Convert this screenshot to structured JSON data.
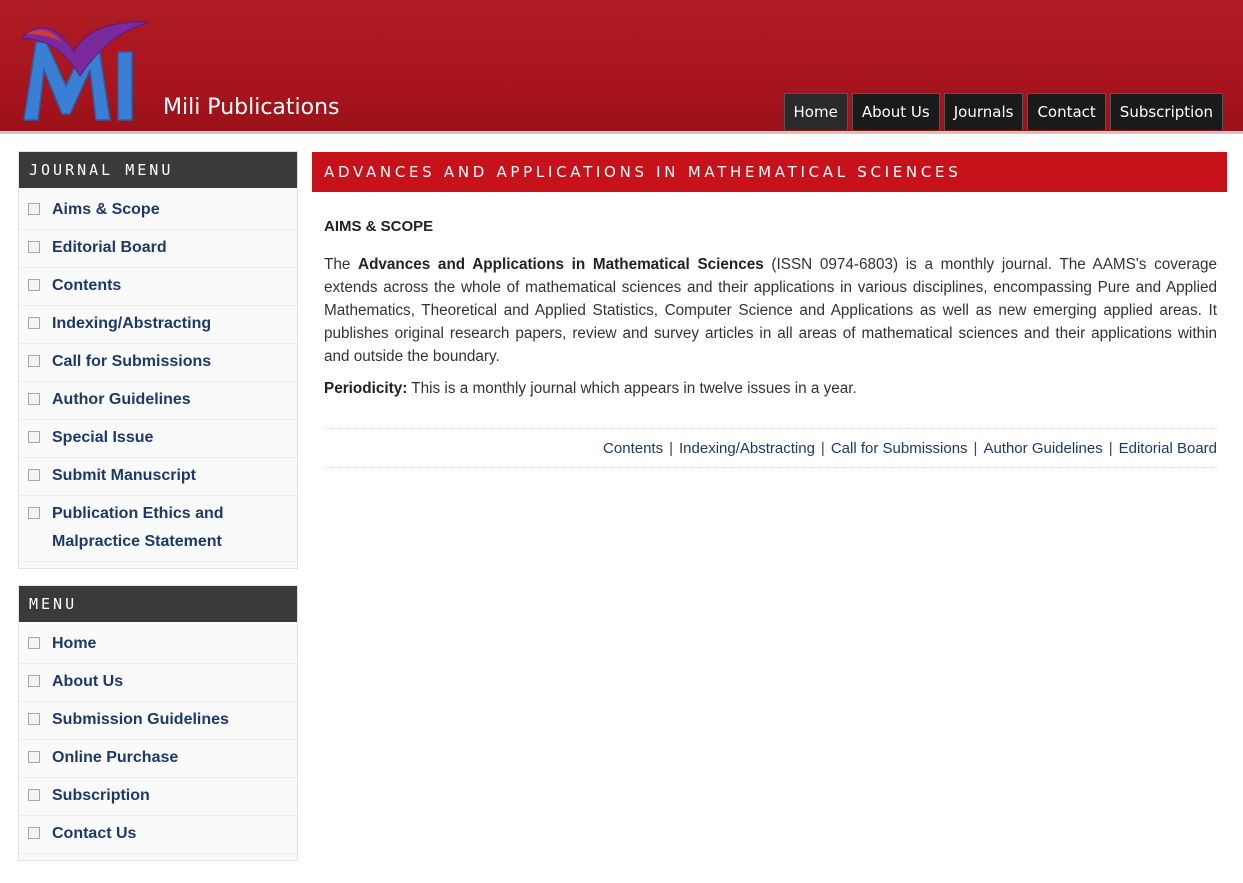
{
  "header": {
    "site_title": "Mili Publications",
    "nav": [
      "Home",
      "About Us",
      "Journals",
      "Contact",
      "Subscription"
    ],
    "active_nav": "Home"
  },
  "sidebar": {
    "journal_menu": {
      "heading": "JOURNAL MENU",
      "items": [
        "Aims & Scope",
        "Editorial Board",
        "Contents",
        "Indexing/Abstracting",
        "Call for Submissions",
        "Author Guidelines",
        "Special Issue",
        "Submit Manuscript",
        "Publication Ethics and Malpractice Statement"
      ]
    },
    "menu": {
      "heading": "MENU",
      "items": [
        "Home",
        "About Us",
        "Submission Guidelines",
        "Online Purchase",
        "Subscription",
        "Contact Us"
      ]
    }
  },
  "main": {
    "journal_title": "ADVANCES AND APPLICATIONS IN MATHEMATICAL SCIENCES",
    "section_title": "AIMS & SCOPE",
    "intro_prefix": "The ",
    "intro_bold": "Advances and Applications in Mathematical Sciences",
    "intro_rest": " (ISSN 0974-6803) is a monthly journal. The AAMS's coverage extends across the whole of mathematical sciences and their applications in various disciplines, encompassing Pure and Applied Mathematics, Theoretical and Applied Statistics, Computer Science and Applications as well as new emerging applied areas. It publishes original research papers, review and survey articles in all areas of mathematical sciences and their applications within and outside the boundary.",
    "periodicity_label": "Periodicity:",
    "periodicity_text": " This is a monthly journal which appears in twelve issues in a year.",
    "links": [
      "Contents",
      "Indexing/Abstracting",
      "Call for Submissions",
      "Author Guidelines",
      "Editorial Board"
    ],
    "link_separator": "|"
  },
  "colors": {
    "header_red": "#a8151e",
    "title_bar_red": "#c8121b",
    "menu_head": "#3a3a3a",
    "link_blue": "#1b3a6b"
  }
}
